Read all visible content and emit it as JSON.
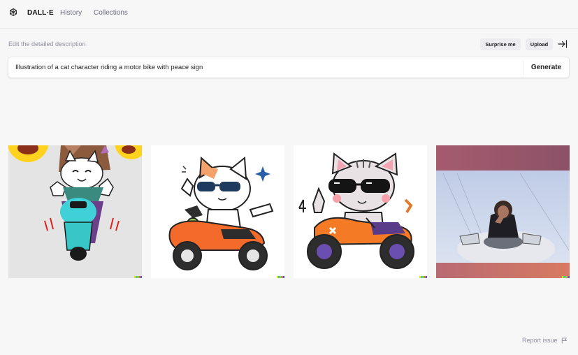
{
  "header": {
    "brand": "DALL·E",
    "nav": [
      {
        "label": "History"
      },
      {
        "label": "Collections"
      }
    ],
    "logo_icon": "openai-logo-icon"
  },
  "editor": {
    "label": "Edit the detailed description",
    "surprise_label": "Surprise me",
    "upload_label": "Upload",
    "collapse_icon": "arrow-right-to-bar-icon",
    "prompt_value": "Illustration of a cat character riding a motor bike with peace sign",
    "generate_label": "Generate"
  },
  "results": {
    "images": [
      {
        "subject": "photo-collage cat character on teal scooter with emoji faces"
      },
      {
        "subject": "white cat with sunglasses on orange scooter, peace sign"
      },
      {
        "subject": "grey cat with sunglasses on orange motorbike, peace sign"
      },
      {
        "subject": "person posing on white vehicle under blue sky"
      }
    ],
    "signature_colors": [
      "#f2e600",
      "#46c4c4",
      "#7ad54c",
      "#ff6b3d",
      "#3d5cff"
    ]
  },
  "footer": {
    "report_label": "Report issue",
    "report_icon": "flag-icon"
  },
  "colors": {
    "background": "#f7f7f8",
    "text": "#202123",
    "muted": "#8e8ea0",
    "button_bg": "#ececf1"
  }
}
